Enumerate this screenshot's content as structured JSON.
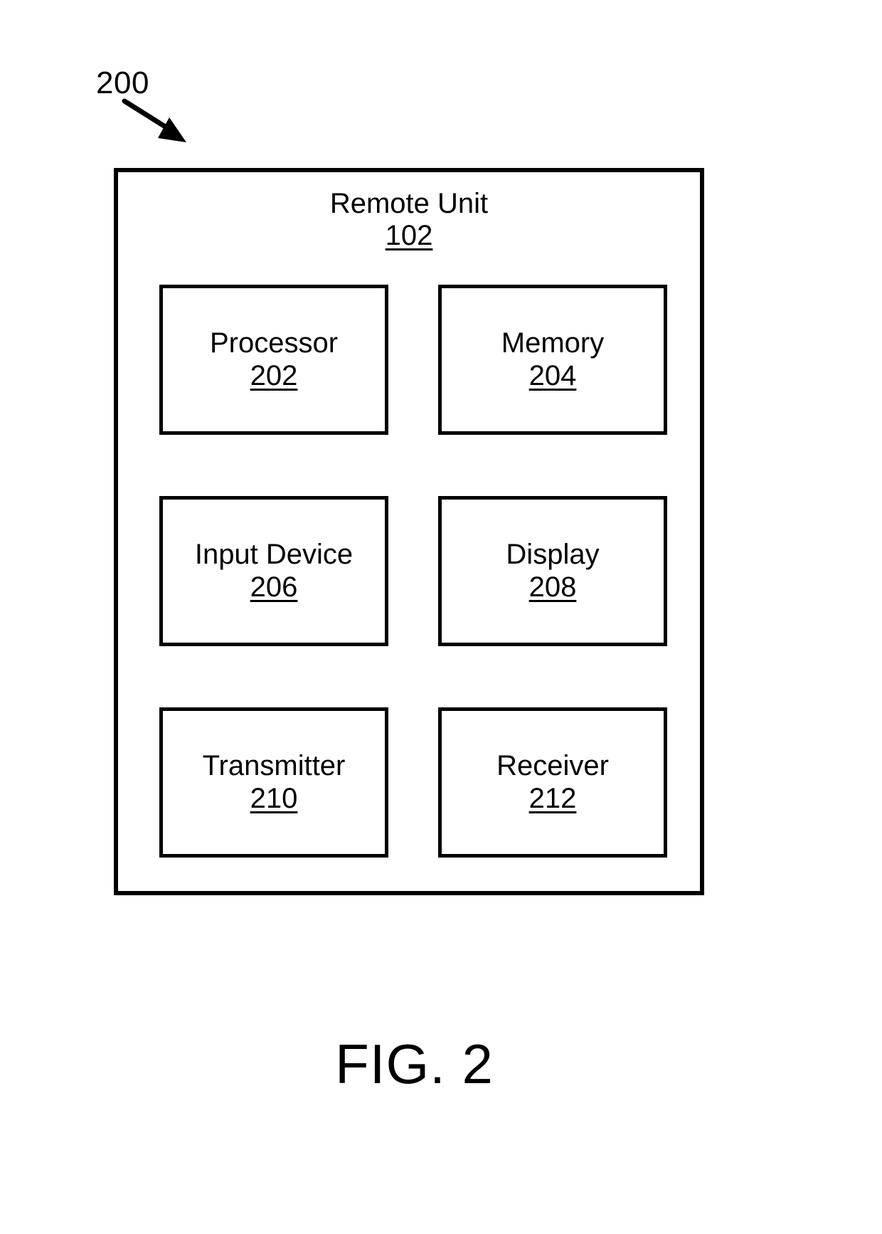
{
  "figure": {
    "reference_label": "200",
    "caption": "FIG. 2",
    "arrow_icon": "diagonal-arrow-icon"
  },
  "outer_unit": {
    "title": "Remote Unit",
    "reference_number": "102"
  },
  "components": [
    {
      "name": "Processor",
      "reference_number": "202",
      "slot": "processor"
    },
    {
      "name": "Memory",
      "reference_number": "204",
      "slot": "memory"
    },
    {
      "name": "Input Device",
      "reference_number": "206",
      "slot": "input-device"
    },
    {
      "name": "Display",
      "reference_number": "208",
      "slot": "display"
    },
    {
      "name": "Transmitter",
      "reference_number": "210",
      "slot": "transmitter"
    },
    {
      "name": "Receiver",
      "reference_number": "212",
      "slot": "receiver"
    }
  ],
  "colors": {
    "stroke": "#000000",
    "background": "#ffffff"
  }
}
